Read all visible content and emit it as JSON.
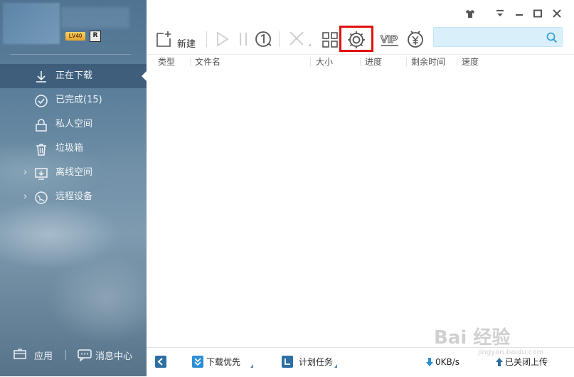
{
  "sidebar": {
    "level_badge": "LV40",
    "vip_badge": "R",
    "items": [
      {
        "label": "正在下载",
        "icon": "download-arrow-icon",
        "active": true
      },
      {
        "label": "已完成(15)",
        "icon": "check-circle-icon"
      },
      {
        "label": "私人空间",
        "icon": "lock-icon"
      },
      {
        "label": "垃圾箱",
        "icon": "trash-icon"
      },
      {
        "label": "离线空间",
        "icon": "cloud-drive-icon",
        "expandable": true
      },
      {
        "label": "远程设备",
        "icon": "globe-icon",
        "expandable": true
      }
    ],
    "bottom": {
      "app_label": "应用",
      "message_label": "消息中心"
    }
  },
  "window": {
    "buttons": [
      "skin-icon",
      "menu-icon",
      "minimize-icon",
      "maximize-icon",
      "close-icon"
    ]
  },
  "toolbar": {
    "new_label": "新建",
    "buttons": [
      "new-task",
      "start",
      "pause",
      "speed-limit",
      "delete",
      "view-grid",
      "settings",
      "vip",
      "wallet"
    ],
    "vip_label": "VIP",
    "highlighted": "settings"
  },
  "search": {
    "placeholder": "",
    "value": ""
  },
  "table": {
    "columns": [
      "类型",
      "文件名",
      "大小",
      "进度",
      "剩余时间",
      "速度"
    ]
  },
  "statusbar": {
    "download_priority": "下载优先",
    "scheduled_tasks": "计划任务",
    "download_speed": "0KB/s",
    "upload_status": "已关闭上传"
  },
  "watermark": {
    "text": "Bai 经验",
    "sub": "jingyan.baidu.com"
  },
  "colors": {
    "accent": "#2d6fa3",
    "highlight": "#e01010",
    "search_bg": "#d9f0fb",
    "sidebar_text": "#eef3f7",
    "speed_arrow": "#2d8fd5",
    "upload_arrow": "#2d6fa3"
  }
}
